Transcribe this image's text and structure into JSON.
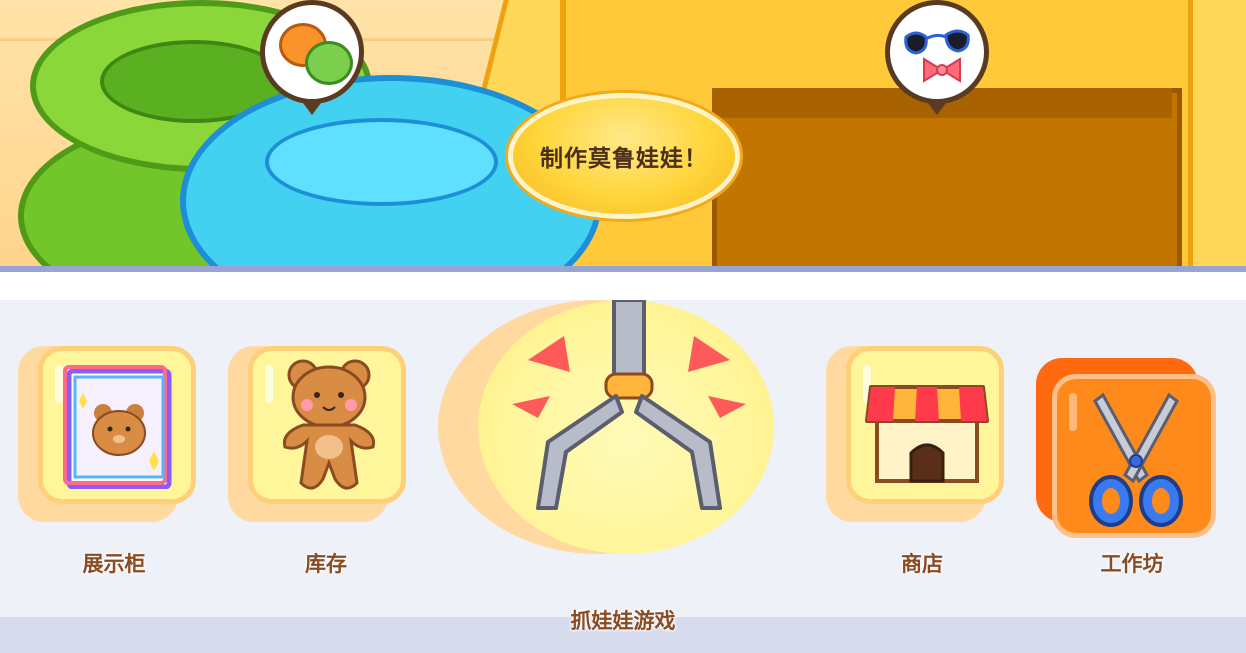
{
  "scene": {
    "make_button_label": "制作莫鲁娃娃！",
    "bubble_left_icon": "fluff-materials-icon",
    "bubble_right_icon": "accessories-icon"
  },
  "menu": {
    "items": [
      {
        "label": "展示柜",
        "icon": "display-cabinet-icon"
      },
      {
        "label": "库存",
        "icon": "bear-inventory-icon"
      },
      {
        "label": "商店",
        "icon": "shop-icon"
      },
      {
        "label": "工作坊",
        "icon": "scissors-icon",
        "selected": true
      }
    ],
    "center": {
      "label": "抓娃娃游戏",
      "icon": "claw-icon"
    }
  },
  "colors": {
    "accent_orange": "#ff7a1a",
    "tile_yellow": "#fff59a",
    "label_brown": "#8a4a22"
  }
}
